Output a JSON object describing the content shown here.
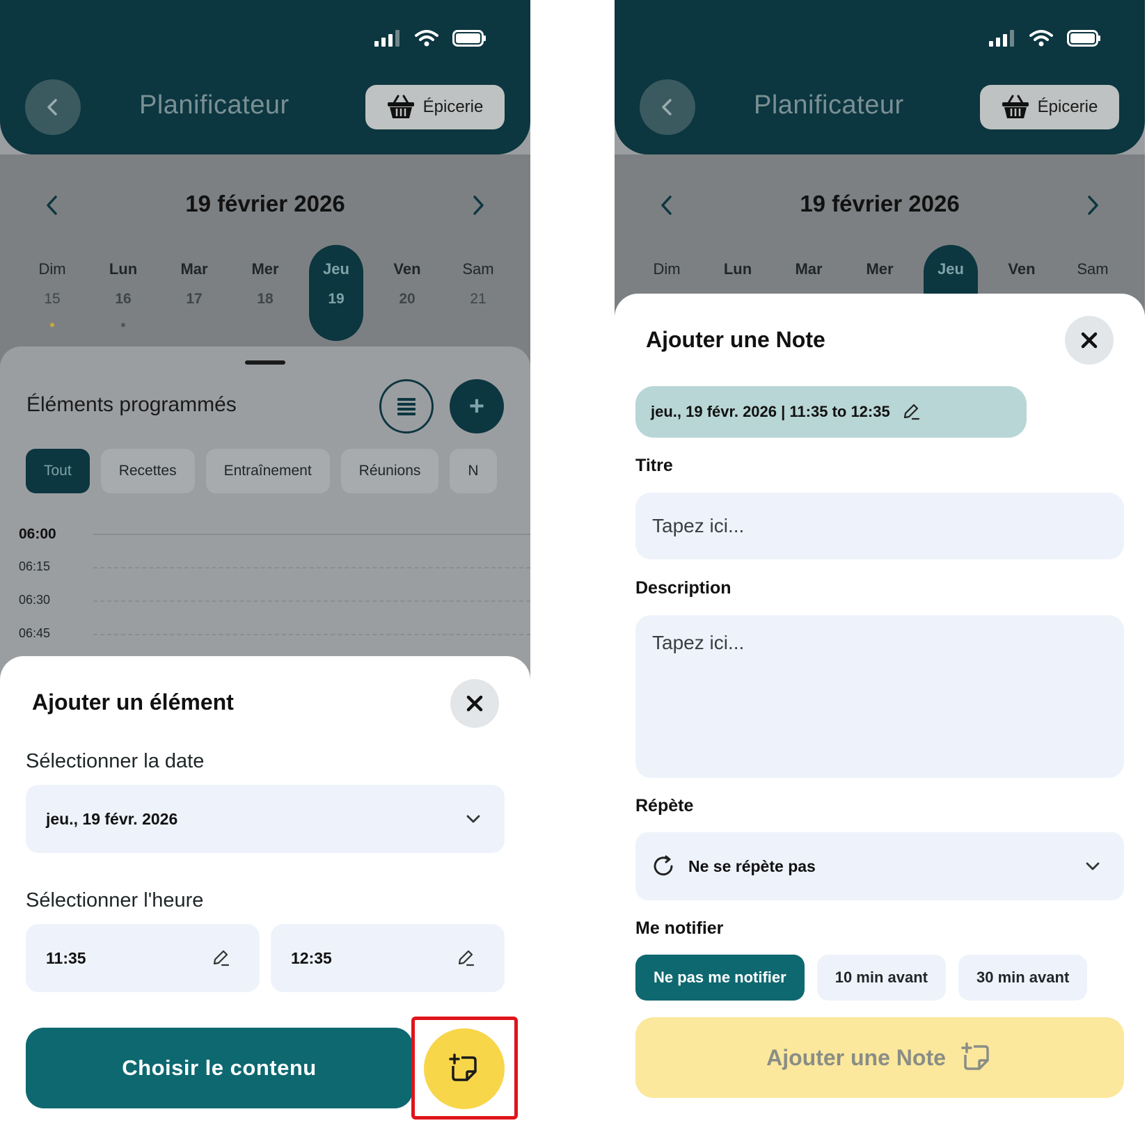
{
  "header": {
    "title": "Planificateur",
    "grocery_label": "Épicerie"
  },
  "calendar": {
    "date_title": "19 février 2026",
    "days": [
      {
        "name": "Dim",
        "num": "15"
      },
      {
        "name": "Lun",
        "num": "16"
      },
      {
        "name": "Mar",
        "num": "17"
      },
      {
        "name": "Mer",
        "num": "18"
      },
      {
        "name": "Jeu",
        "num": "19"
      },
      {
        "name": "Ven",
        "num": "20"
      },
      {
        "name": "Sam",
        "num": "21"
      }
    ]
  },
  "scheduled": {
    "title": "Éléments programmés",
    "filters": [
      "Tout",
      "Recettes",
      "Entraînement",
      "Réunions",
      "N"
    ],
    "times": [
      "06:00",
      "06:15",
      "06:30",
      "06:45"
    ]
  },
  "add_item": {
    "title": "Ajouter un élément",
    "date_label": "Sélectionner la date",
    "date_value": "jeu., 19 févr. 2026",
    "time_label": "Sélectionner l'heure",
    "start_time": "11:35",
    "end_time": "12:35",
    "choose_content": "Choisir le contenu"
  },
  "add_note": {
    "title": "Ajouter une Note",
    "date_chip": "jeu., 19 févr. 2026 | 11:35 to 12:35",
    "title_label": "Titre",
    "title_placeholder": "Tapez ici...",
    "description_label": "Description",
    "description_placeholder": "Tapez ici...",
    "repeat_label": "Répète",
    "repeat_value": "Ne se répète pas",
    "notify_label": "Me notifier",
    "notify_options": [
      "Ne pas me notifier",
      "10 min avant",
      "30 min avant"
    ],
    "submit_label": "Ajouter une Note"
  },
  "colors": {
    "header": "#0c3640",
    "primary": "#0e6870",
    "accent_yellow": "#f7d64a",
    "highlight": "#e0141b"
  }
}
